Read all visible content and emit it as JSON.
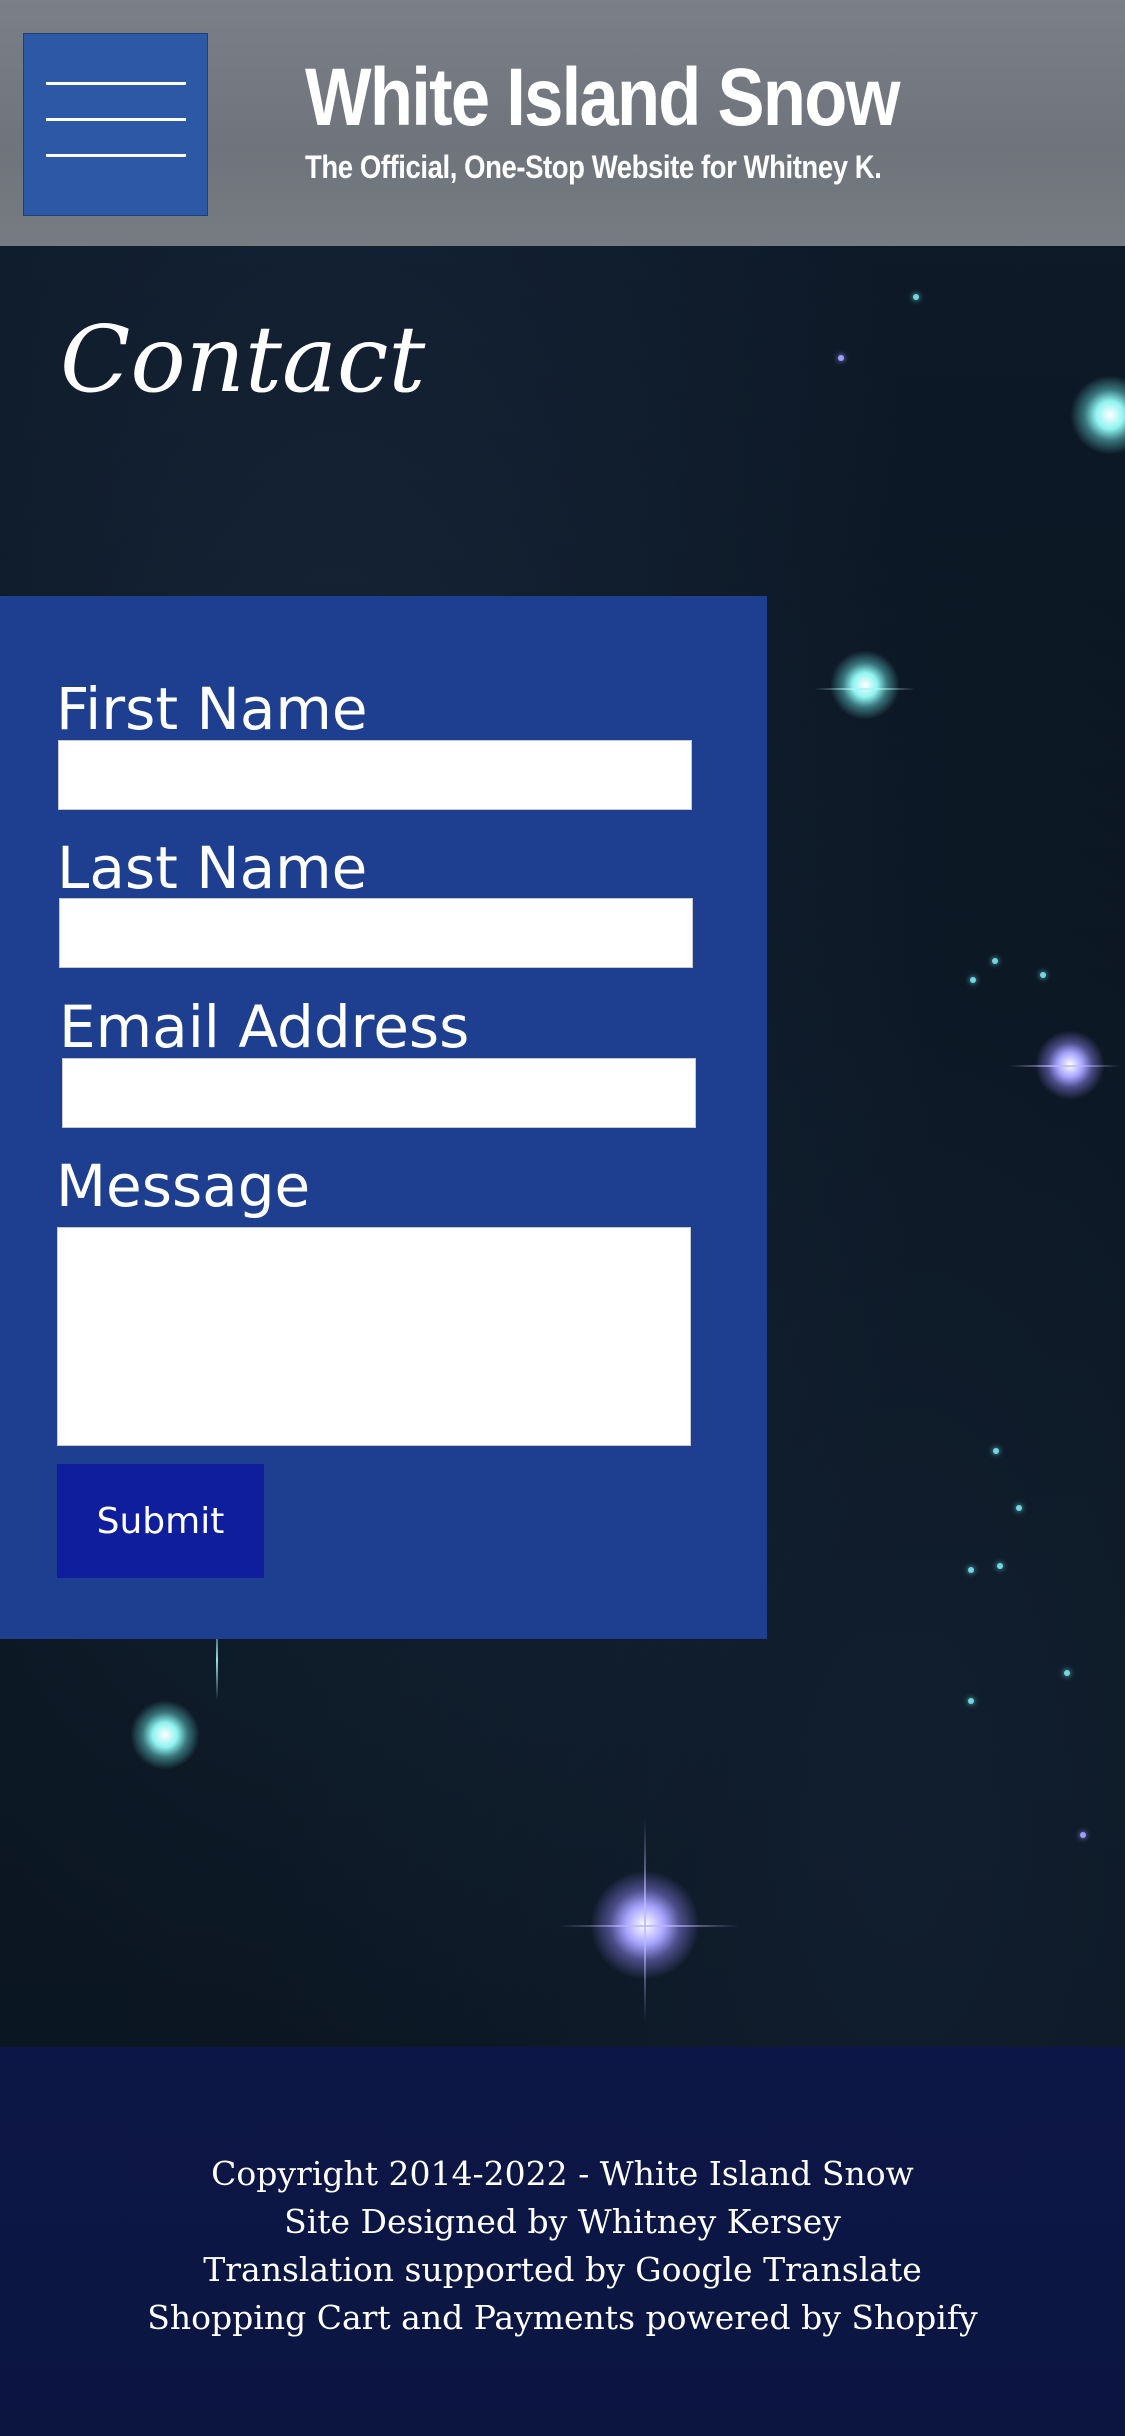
{
  "header": {
    "title": "White Island Snow",
    "subtitle": "The Official, One-Stop Website for Whitney K.",
    "menu_icon": "hamburger-menu-icon"
  },
  "main": {
    "heading": "Contact"
  },
  "form": {
    "first_name_label": "First Name",
    "first_name_value": "",
    "last_name_label": "Last Name",
    "last_name_value": "",
    "email_label": "Email Address",
    "email_value": "",
    "message_label": "Message",
    "message_value": "",
    "submit_label": "Submit"
  },
  "footer": {
    "lines": [
      "Copyright 2014-2022 - White Island Snow",
      "Site Designed by Whitney Kersey",
      "Translation supported by Google Translate",
      "Shopping Cart and Payments powered by Shopify"
    ]
  },
  "colors": {
    "header_bg": "#767a82",
    "menu_button_bg": "#2d58a6",
    "form_panel_bg": "#1e3f8f",
    "submit_bg": "#0f1e9c",
    "footer_bg": "#0d1747",
    "page_bg": "#0b1624"
  }
}
